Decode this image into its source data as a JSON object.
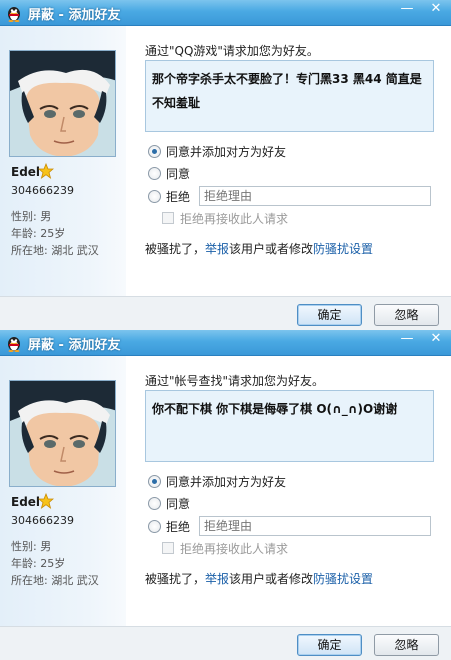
{
  "colors": {
    "titlebar": "#4aa9e3",
    "link": "#1a5fa8",
    "message_bg": "#e8f3fb"
  },
  "dialogs": [
    {
      "title": "屏蔽 - 添加好友",
      "icon": "qq-penguin-icon",
      "controls": {
        "minimize": "—",
        "close": "✕"
      },
      "profile": {
        "avatar": "anime-boy-avatar",
        "nickname": "Edel",
        "badge_icon": "star-icon",
        "qq_number": "304666239",
        "gender_label": "性别:",
        "gender": "男",
        "age_label": "年龄:",
        "age": "25岁",
        "location_label": "所在地:",
        "location": "湖北  武汉"
      },
      "request_caption": "通过\"QQ游戏\"请求加您为好友。",
      "request_message": "那个帝字杀手太不要脸了！专门黑33 黑44 简直是不知羞耻",
      "options": {
        "accept_add": "同意并添加对方为好友",
        "accept": "同意",
        "reject": "拒绝",
        "selected": "accept_add"
      },
      "reject_placeholder": "拒绝理由",
      "block_future": "拒绝再接收此人请求",
      "harass_prefix": "被骚扰了，",
      "report_link": "举报",
      "harass_middle": "该用户或者修改",
      "settings_link": "防骚扰设置",
      "buttons": {
        "confirm": "确定",
        "ignore": "忽略"
      }
    },
    {
      "title": "屏蔽 - 添加好友",
      "icon": "qq-penguin-icon",
      "controls": {
        "minimize": "—",
        "close": "✕"
      },
      "profile": {
        "avatar": "anime-boy-avatar",
        "nickname": "Edel",
        "badge_icon": "star-icon",
        "qq_number": "304666239",
        "gender_label": "性别:",
        "gender": "男",
        "age_label": "年龄:",
        "age": "25岁",
        "location_label": "所在地:",
        "location": "湖北  武汉"
      },
      "request_caption": "通过\"帐号查找\"请求加您为好友。",
      "request_message": "你不配下棋  你下棋是侮辱了棋 O(∩_∩)O谢谢",
      "options": {
        "accept_add": "同意并添加对方为好友",
        "accept": "同意",
        "reject": "拒绝",
        "selected": "accept_add"
      },
      "reject_placeholder": "拒绝理由",
      "block_future": "拒绝再接收此人请求",
      "harass_prefix": "被骚扰了，",
      "report_link": "举报",
      "harass_middle": "该用户或者修改",
      "settings_link": "防骚扰设置",
      "buttons": {
        "confirm": "确定",
        "ignore": "忽略"
      }
    }
  ]
}
